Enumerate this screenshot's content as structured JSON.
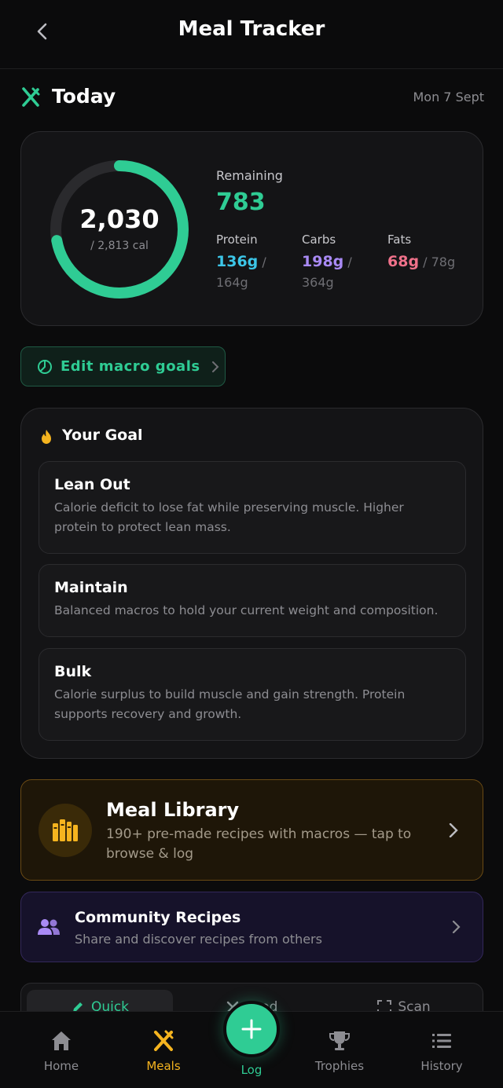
{
  "header": {
    "title": "Meal Tracker",
    "back_icon": "chevron-left-icon"
  },
  "today": {
    "title": "Today",
    "date": "Mon 7 Sept",
    "icon": "fork-knife-icon"
  },
  "summary": {
    "consumed": "2,030",
    "target_text": "/ 2,813 cal",
    "ring_progress": 0.7217,
    "remaining_label": "Remaining",
    "remaining_value": "783",
    "macros": [
      {
        "label": "Protein",
        "value": "136g",
        "goal": "/ 164g",
        "color": "#3cc6e8"
      },
      {
        "label": "Carbs",
        "value": "198g",
        "goal": "/ 364g",
        "color": "#a98af5"
      },
      {
        "label": "Fats",
        "value": "68g",
        "goal": "/ 78g",
        "color": "#f0718a"
      }
    ]
  },
  "edit_goals": {
    "label": "Edit macro goals",
    "icon": "pie-chart-icon"
  },
  "goal": {
    "title": "Your Goal",
    "icon": "flame-icon",
    "options": [
      {
        "title": "Lean Out",
        "desc": "Calorie deficit to lose fat while preserving muscle. Higher protein to protect lean mass."
      },
      {
        "title": "Maintain",
        "desc": "Balanced macros to hold your current weight and composition."
      },
      {
        "title": "Bulk",
        "desc": "Calorie surplus to build muscle and gain strength. Protein supports recovery and growth."
      }
    ]
  },
  "library": {
    "title": "Meal Library",
    "desc": "190+ pre-made recipes with macros — tap to browse & log",
    "icon": "book-library-icon"
  },
  "community": {
    "title": "Community Recipes",
    "desc": "Share and discover recipes from others",
    "icon": "users-icon"
  },
  "log_tabs": [
    {
      "label": "Quick",
      "icon": "pencil-icon"
    },
    {
      "label": "Food",
      "icon": "fork-knife-icon"
    },
    {
      "label": "Scan",
      "icon": "scan-icon"
    }
  ],
  "nav": {
    "items": [
      {
        "label": "Home",
        "icon": "home-icon"
      },
      {
        "label": "Meals",
        "icon": "fork-knife-icon"
      },
      {
        "label": "Log",
        "icon": "plus-icon"
      },
      {
        "label": "Trophies",
        "icon": "trophy-icon"
      },
      {
        "label": "History",
        "icon": "list-icon"
      }
    ]
  },
  "colors": {
    "accent": "#2fcc94",
    "meals_active": "#f5b41f",
    "library": "#f5b41f",
    "community": "#a98af5"
  }
}
